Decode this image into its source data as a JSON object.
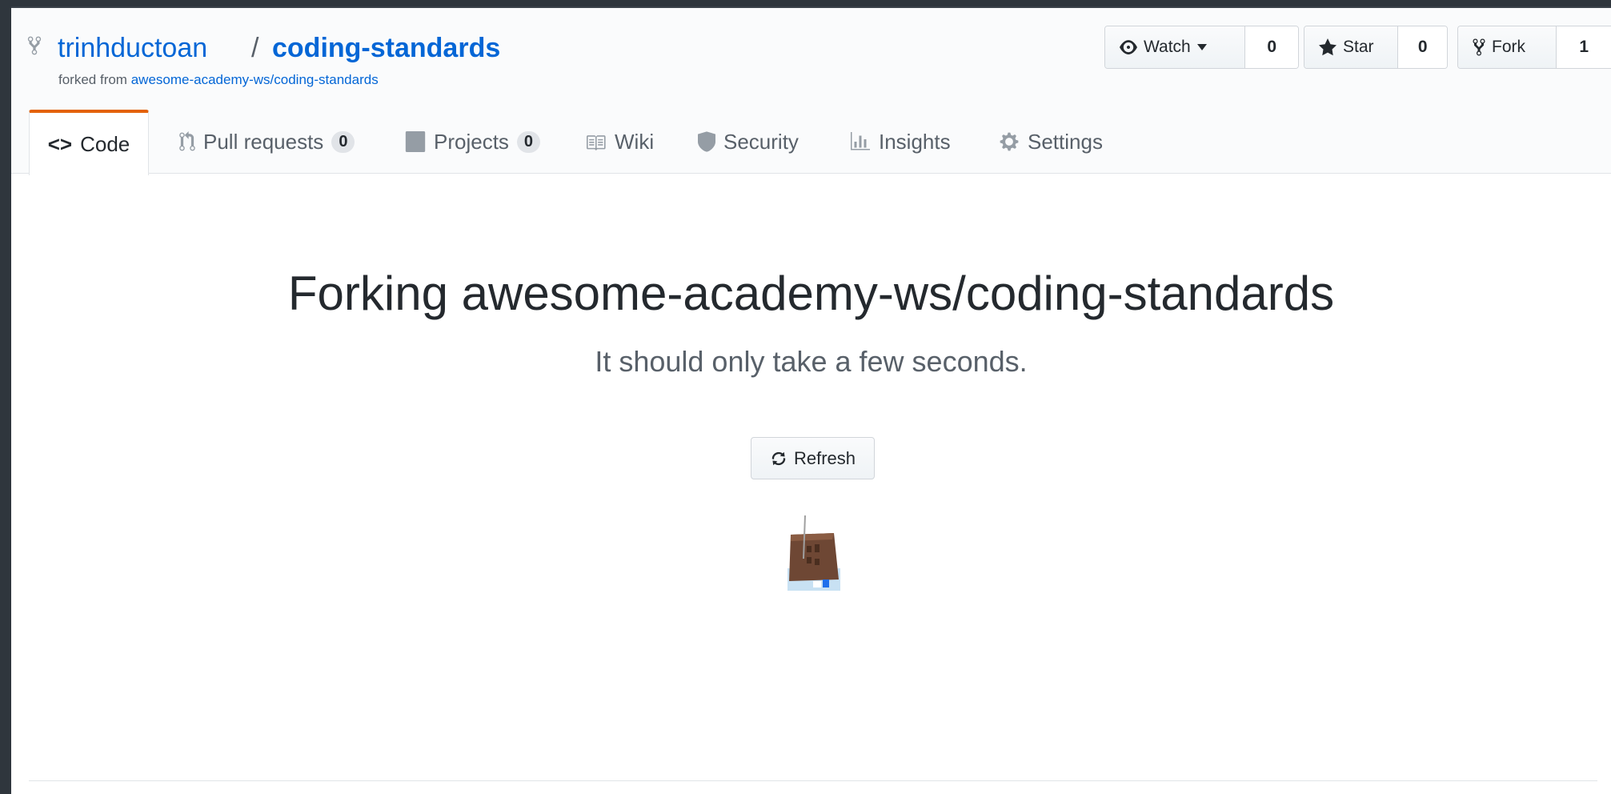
{
  "repo": {
    "owner": "trinhductoan",
    "separator": "/",
    "name": "coding-standards",
    "forked_prefix": "forked from",
    "forked_source": "awesome-academy-ws/coding-standards"
  },
  "actions": {
    "watch": {
      "label": "Watch",
      "count": "0",
      "icon": "eye-icon"
    },
    "star": {
      "label": "Star",
      "count": "0",
      "icon": "star-icon"
    },
    "fork": {
      "label": "Fork",
      "count": "1",
      "icon": "repo-forked-icon"
    }
  },
  "nav": {
    "tabs": [
      {
        "label": "Code",
        "icon": "code-icon",
        "selected": true
      },
      {
        "label": "Pull requests",
        "count": "0",
        "icon": "git-pull-request-icon"
      },
      {
        "label": "Projects",
        "count": "0",
        "icon": "project-icon"
      },
      {
        "label": "Wiki",
        "icon": "book-icon"
      },
      {
        "label": "Security",
        "icon": "shield-icon"
      },
      {
        "label": "Insights",
        "icon": "graph-icon"
      },
      {
        "label": "Settings",
        "icon": "gear-icon"
      }
    ]
  },
  "main": {
    "title": "Forking awesome-academy-ws/coding-standards",
    "subtitle": "It should only take a few seconds.",
    "refresh_label": "Refresh"
  },
  "colors": {
    "link": "#0366d6",
    "selected_tab_accent": "#e36209",
    "muted_text": "#586069",
    "outer_frame": "#2f363d"
  }
}
